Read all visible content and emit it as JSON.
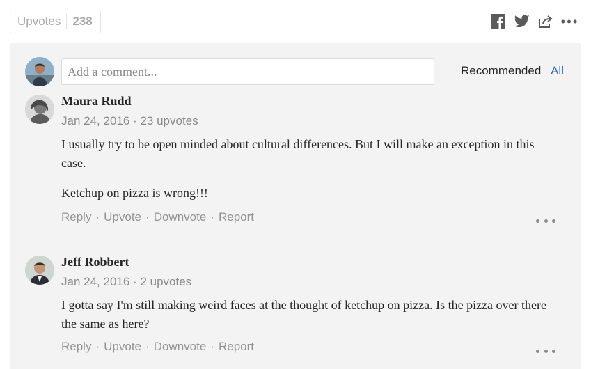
{
  "upvotes": {
    "label": "Upvotes",
    "count": "238"
  },
  "share": {
    "icons": [
      "facebook-icon",
      "twitter-icon",
      "share-icon",
      "more-options-icon"
    ]
  },
  "comment_box": {
    "placeholder": "Add a comment..."
  },
  "sort": {
    "recommended": "Recommended",
    "all": "All"
  },
  "comments": [
    {
      "author": "Maura Rudd",
      "date": "Jan 24, 2016",
      "upvotes": "23 upvotes",
      "paragraphs": [
        "I usually try to be open minded about cultural differences. But I will make an exception in this case.",
        "Ketchup on pizza is wrong!!!"
      ]
    },
    {
      "author": "Jeff Robbert",
      "date": "Jan 24, 2016",
      "upvotes": "2 upvotes",
      "paragraphs": [
        "I gotta say I'm still making weird faces at the thought of ketchup on pizza. Is the pizza over there the same as here?"
      ]
    }
  ],
  "actions": {
    "reply": "Reply",
    "upvote": "Upvote",
    "downvote": "Downvote",
    "report": "Report",
    "separator": "·"
  },
  "colors": {
    "link": "#2b6dad",
    "panel_bg": "#f3f3f3",
    "muted": "#8a8a8a"
  }
}
